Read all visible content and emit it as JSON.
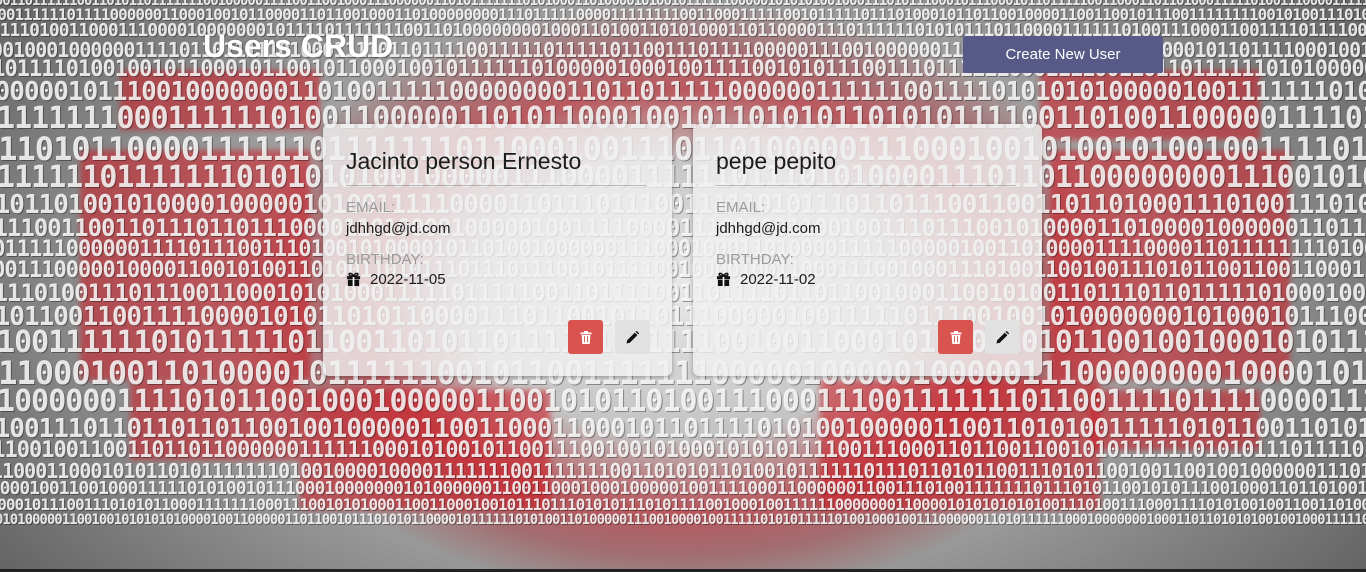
{
  "header": {
    "title": "Users CRUD",
    "create_button_label": "Create New User"
  },
  "labels": {
    "email": "EMAIL:",
    "birthday": "BIRTHDAY:"
  },
  "users": [
    {
      "name": "Jacinto person Ernesto",
      "email": "jdhhgd@jd.com",
      "birthday": "2022-11-05"
    },
    {
      "name": "pepe pepito",
      "email": "jdhhgd@jd.com",
      "birthday": "2022-11-02"
    }
  ],
  "icons": {
    "birthday": "gift-icon",
    "delete": "trash-icon",
    "edit": "pencil-icon"
  },
  "colors": {
    "create_button": "#575a86",
    "delete_button": "#d9534f",
    "edit_button": "#e1e1e1",
    "card_background": "rgba(240,240,240,0.80)"
  }
}
